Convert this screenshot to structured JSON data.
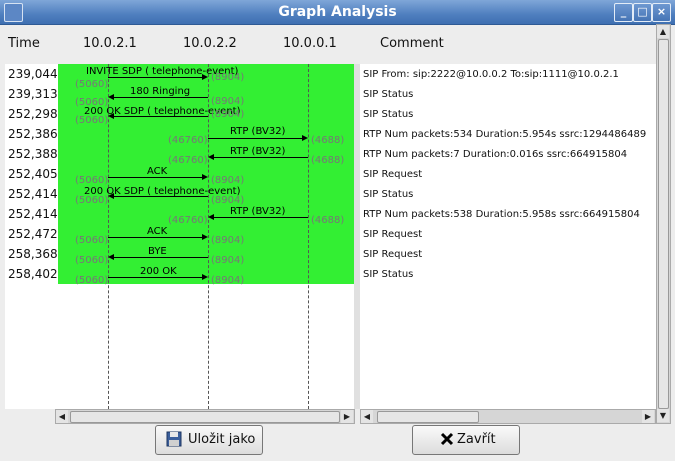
{
  "window": {
    "title": "Graph Analysis",
    "controls": {
      "minimize": "_",
      "maximize": "□",
      "close": "×"
    }
  },
  "header": {
    "time_label": "Time",
    "hosts": [
      "10.0.2.1",
      "10.0.2.2",
      "10.0.0.1"
    ],
    "comment_label": "Comment"
  },
  "times": [
    "239,044",
    "239,313",
    "252,298",
    "252,386",
    "252,388",
    "252,405",
    "252,414",
    "252,414",
    "252,472",
    "258,368",
    "258,402"
  ],
  "ports": {
    "p5060": "(5060)",
    "p8904": "(8904)",
    "p46760": "(46760)",
    "p4688": "(4688)"
  },
  "messages": [
    "INVITE SDP ( telephone-event)",
    "180 Ringing",
    "200 OK SDP ( telephone-event)",
    "RTP (BV32)",
    "RTP (BV32)",
    "ACK",
    "200 OK SDP ( telephone-event)",
    "RTP (BV32)",
    "ACK",
    "BYE",
    "200 OK"
  ],
  "comments": [
    "SIP From: sip:2222@10.0.0.2 To:sip:1111@10.0.2.1",
    "SIP Status",
    "SIP Status",
    "RTP Num packets:534  Duration:5.954s ssrc:1294486489",
    "RTP Num packets:7  Duration:0.016s ssrc:664915804",
    "SIP Request",
    "SIP Status",
    "RTP Num packets:538  Duration:5.958s ssrc:664915804",
    "SIP Request",
    "SIP Request",
    "SIP Status"
  ],
  "buttons": {
    "save": "Uložit jako",
    "close": "Zavřít"
  },
  "colors": {
    "graph_background": "#33ef33",
    "titlebar": "#4f7fbf"
  },
  "icons": {
    "save": "floppy-disk-icon",
    "close": "x-icon"
  }
}
